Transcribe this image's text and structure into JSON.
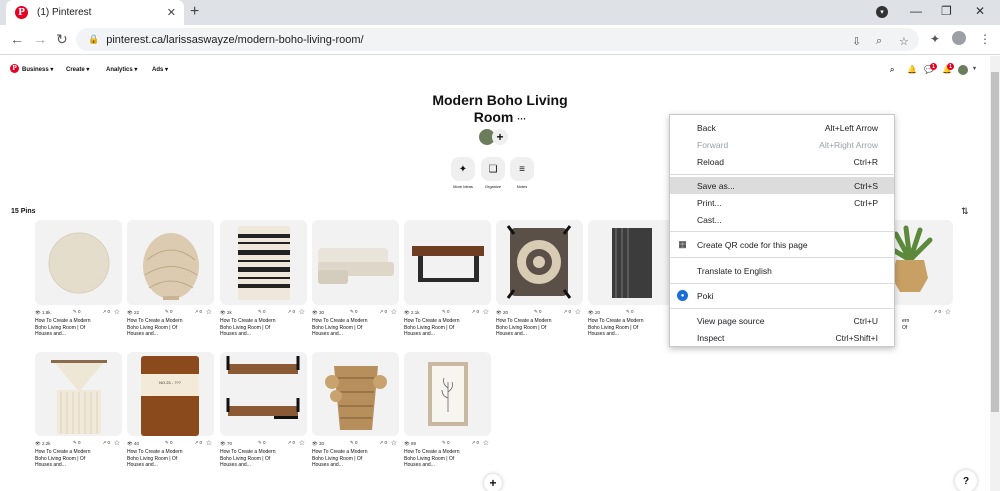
{
  "browser": {
    "tab_title": "(1) Pinterest",
    "url": "pinterest.ca/larissaswayze/modern-boho-living-room/"
  },
  "pinterest_nav": {
    "logo": "P",
    "items": [
      "Business",
      "Create",
      "Analytics",
      "Ads"
    ],
    "notification_badge": "1",
    "message_badge": "1"
  },
  "board": {
    "title_line1": "Modern Boho Living",
    "title_line2": "Room",
    "more": "···",
    "tools": [
      "More ideas",
      "Organize",
      "Notes"
    ],
    "pin_count": "15 Pins"
  },
  "pins_row1": [
    {
      "views": "1.8k",
      "saves": "0"
    },
    {
      "views": "22",
      "saves": "0"
    },
    {
      "views": "2k",
      "saves": "0"
    },
    {
      "views": "30",
      "saves": "0"
    },
    {
      "views": "2.1k",
      "saves": "0"
    },
    {
      "views": "20",
      "saves": "0"
    },
    {
      "views": "20",
      "saves": "0"
    }
  ],
  "pins_row2": [
    {
      "views": "2.2k",
      "saves": "0"
    },
    {
      "views": "40",
      "saves": "0"
    },
    {
      "views": "70",
      "saves": "0"
    },
    {
      "views": "30",
      "saves": "0"
    },
    {
      "views": "89",
      "saves": "0"
    }
  ],
  "pin_text": {
    "line1": "How To Create a Modern",
    "line2": "Boho Living Room | Of",
    "line3": "Houses and..."
  },
  "partial_pin_text": {
    "line1": "ern",
    "line2": "Of"
  },
  "candle_label": "NO.23 - ???",
  "context_menu": {
    "items": [
      {
        "label": "Back",
        "shortcut": "Alt+Left Arrow"
      },
      {
        "label": "Forward",
        "shortcut": "Alt+Right Arrow"
      },
      {
        "label": "Reload",
        "shortcut": "Ctrl+R"
      },
      {
        "label": "Save as...",
        "shortcut": "Ctrl+S"
      },
      {
        "label": "Print...",
        "shortcut": "Ctrl+P"
      },
      {
        "label": "Cast...",
        "shortcut": ""
      },
      {
        "label": "Create QR code for this page",
        "shortcut": ""
      },
      {
        "label": "Translate to English",
        "shortcut": ""
      },
      {
        "label": "Poki",
        "shortcut": ""
      },
      {
        "label": "View page source",
        "shortcut": "Ctrl+U"
      },
      {
        "label": "Inspect",
        "shortcut": "Ctrl+Shift+I"
      }
    ]
  }
}
